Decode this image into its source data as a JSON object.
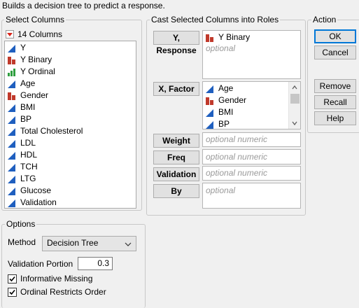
{
  "header": {
    "text": "Builds a decision tree to predict a response."
  },
  "select_columns": {
    "title": "Select Columns",
    "count_label": "14 Columns",
    "items": [
      {
        "label": "Y",
        "icon": "continuous-icon"
      },
      {
        "label": "Y Binary",
        "icon": "nominal-icon"
      },
      {
        "label": "Y Ordinal",
        "icon": "ordinal-icon"
      },
      {
        "label": "Age",
        "icon": "continuous-icon"
      },
      {
        "label": "Gender",
        "icon": "nominal-icon"
      },
      {
        "label": "BMI",
        "icon": "continuous-icon"
      },
      {
        "label": "BP",
        "icon": "continuous-icon"
      },
      {
        "label": "Total Cholesterol",
        "icon": "continuous-icon"
      },
      {
        "label": "LDL",
        "icon": "continuous-icon"
      },
      {
        "label": "HDL",
        "icon": "continuous-icon"
      },
      {
        "label": "TCH",
        "icon": "continuous-icon"
      },
      {
        "label": "LTG",
        "icon": "continuous-icon"
      },
      {
        "label": "Glucose",
        "icon": "continuous-icon"
      },
      {
        "label": "Validation",
        "icon": "continuous-icon"
      }
    ]
  },
  "cast_roles": {
    "title": "Cast Selected Columns into Roles",
    "y_response": {
      "label": "Y, Response",
      "items": [
        {
          "label": "Y Binary",
          "icon": "nominal-icon"
        }
      ],
      "placeholder": "optional"
    },
    "x_factor": {
      "label": "X, Factor",
      "items": [
        {
          "label": "Age",
          "icon": "continuous-icon"
        },
        {
          "label": "Gender",
          "icon": "nominal-icon"
        },
        {
          "label": "BMI",
          "icon": "continuous-icon"
        },
        {
          "label": "BP",
          "icon": "continuous-icon"
        }
      ]
    },
    "weight": {
      "label": "Weight",
      "placeholder": "optional numeric"
    },
    "freq": {
      "label": "Freq",
      "placeholder": "optional numeric"
    },
    "validation": {
      "label": "Validation",
      "placeholder": "optional numeric"
    },
    "by": {
      "label": "By",
      "placeholder": "optional"
    }
  },
  "action": {
    "title": "Action",
    "ok": "OK",
    "cancel": "Cancel",
    "remove": "Remove",
    "recall": "Recall",
    "help": "Help"
  },
  "options": {
    "title": "Options",
    "method_label": "Method",
    "method_value": "Decision Tree",
    "validation_portion_label": "Validation Portion",
    "validation_portion_value": "0.3",
    "informative_missing": {
      "label": "Informative Missing",
      "checked": true
    },
    "ordinal_restricts_order": {
      "label": "Ordinal Restricts Order",
      "checked": true
    }
  },
  "colors": {
    "continuous": "#1f5fbf",
    "nominal": "#c0392b",
    "ordinal": "#2e9e3e"
  }
}
